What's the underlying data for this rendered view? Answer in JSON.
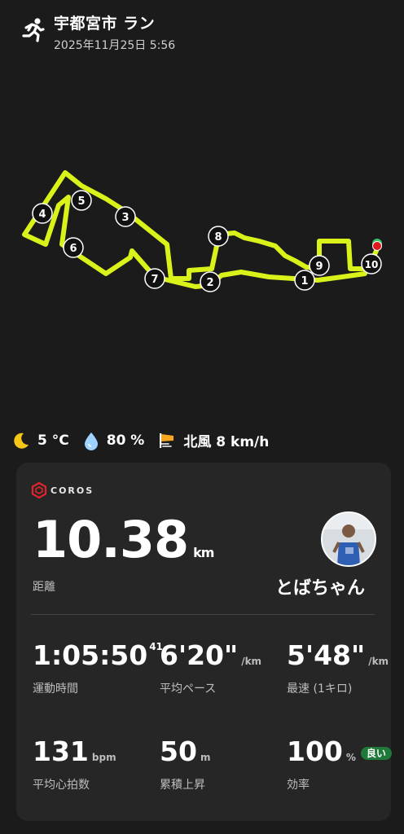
{
  "header": {
    "icon": "running-person-icon",
    "title": "宇都宮市 ラン",
    "datetime": "2025年11月25日 5:56"
  },
  "map": {
    "route_color": "#d9f21a",
    "km_markers": [
      "1",
      "2",
      "3",
      "4",
      "5",
      "6",
      "7",
      "8",
      "9",
      "10"
    ],
    "end_marker_color": "#e0191e",
    "start_marker_color": "#37c46b"
  },
  "weather": {
    "temp": "5 °C",
    "humidity": "80 %",
    "wind": "北風 8 km/h"
  },
  "card": {
    "brand": "COROS",
    "distance": {
      "value": "10.38",
      "unit": "km",
      "label": "距離"
    },
    "user": {
      "name": "とばちゃん"
    },
    "stats": [
      {
        "value": "1:05:50",
        "sup": "41",
        "unit": "",
        "label": "運動時間"
      },
      {
        "value": "6'20\"",
        "unit": "/km",
        "label": "平均ペース"
      },
      {
        "value": "5'48\"",
        "unit": "/km",
        "label": "最速 (1キロ)"
      },
      {
        "value": "131",
        "unit": "bpm",
        "label": "平均心拍数"
      },
      {
        "value": "50",
        "unit": "m",
        "label": "累積上昇"
      },
      {
        "value": "100",
        "unit": "%",
        "label": "効率",
        "badge": "良い"
      }
    ],
    "badge_color": "#1f7a3a"
  }
}
